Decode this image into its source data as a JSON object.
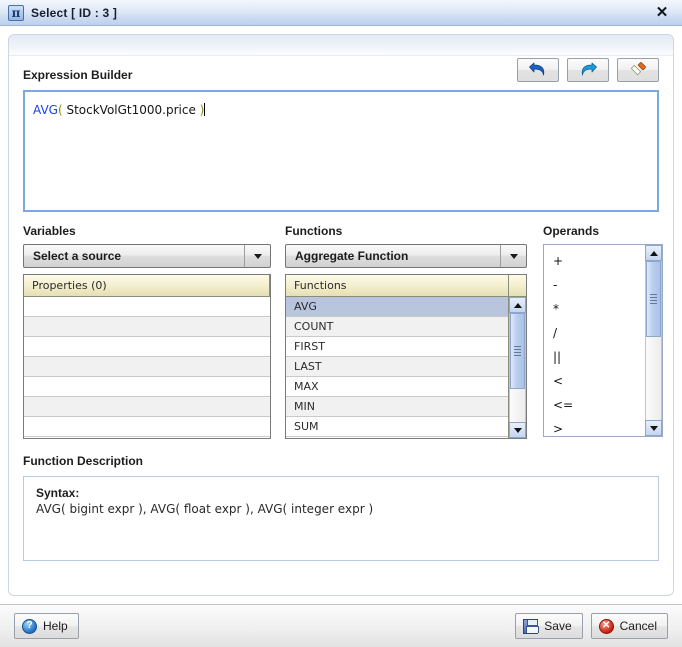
{
  "window": {
    "title": "Select [ ID : 3 ]",
    "icon": "pi-icon",
    "icon_glyph": "π",
    "close_label": "✕"
  },
  "expression_builder": {
    "label": "Expression Builder",
    "toolbar": [
      {
        "name": "undo-button",
        "icon": "undo-icon"
      },
      {
        "name": "redo-button",
        "icon": "redo-icon"
      },
      {
        "name": "clear-button",
        "icon": "eraser-icon"
      }
    ],
    "expression": {
      "function": "AVG",
      "open_paren": "(",
      "argument": " StockVolGt1000.price ",
      "close_paren": ")",
      "full_text": "AVG( StockVolGt1000.price )"
    }
  },
  "variables": {
    "title": "Variables",
    "source_dropdown": {
      "value": "Select a source",
      "arrow": "chevron-down-icon"
    },
    "table": {
      "header": "Properties (0)",
      "rows": [
        "",
        "",
        "",
        "",
        "",
        "",
        ""
      ]
    }
  },
  "functions": {
    "title": "Functions",
    "category_dropdown": {
      "value": "Aggregate Function",
      "arrow": "chevron-down-icon"
    },
    "table": {
      "header": "Functions",
      "rows": [
        "AVG",
        "COUNT",
        "FIRST",
        "LAST",
        "MAX",
        "MIN",
        "SUM"
      ],
      "selected": "AVG"
    }
  },
  "operands": {
    "title": "Operands",
    "items": [
      "+",
      "-",
      "*",
      "/",
      "||",
      "<",
      "<=",
      ">"
    ]
  },
  "function_description": {
    "title": "Function Description",
    "syntax_label": "Syntax:",
    "syntax_value": "AVG( bigint expr ), AVG( float expr ), AVG( integer expr )"
  },
  "footer": {
    "help_label": "Help",
    "save_label": "Save",
    "cancel_label": "Cancel"
  },
  "colors": {
    "accent_blue": "#7aa9dd",
    "selection": "#b9c5dd",
    "table_header": "#f4efcf",
    "token_function": "#1c3ff0",
    "token_paren": "#8a8a21",
    "titlebar": "#c9d9f1"
  }
}
